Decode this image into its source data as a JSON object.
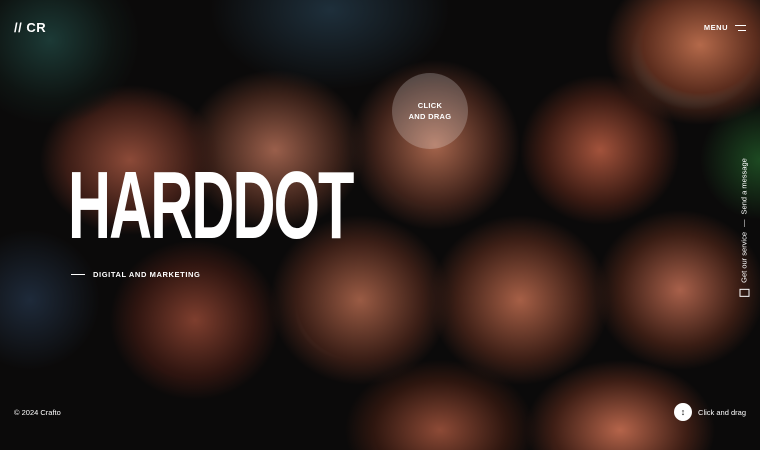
{
  "header": {
    "logo": "// CR",
    "menu_label": "MENU"
  },
  "hero": {
    "drag_hint": "CLICK\nAND DRAG",
    "headline": "HARDDOT",
    "subline": "DIGITAL AND MARKETING"
  },
  "side_links": {
    "service": "Get our service",
    "separator": "—",
    "message": "Send a message"
  },
  "footer": {
    "copyright": "© 2024 Crafto",
    "drag_label": "Click and drag"
  },
  "icons": {
    "menu": "hamburger-icon",
    "mail": "mail-icon",
    "drag": "up-down-arrow-icon"
  }
}
